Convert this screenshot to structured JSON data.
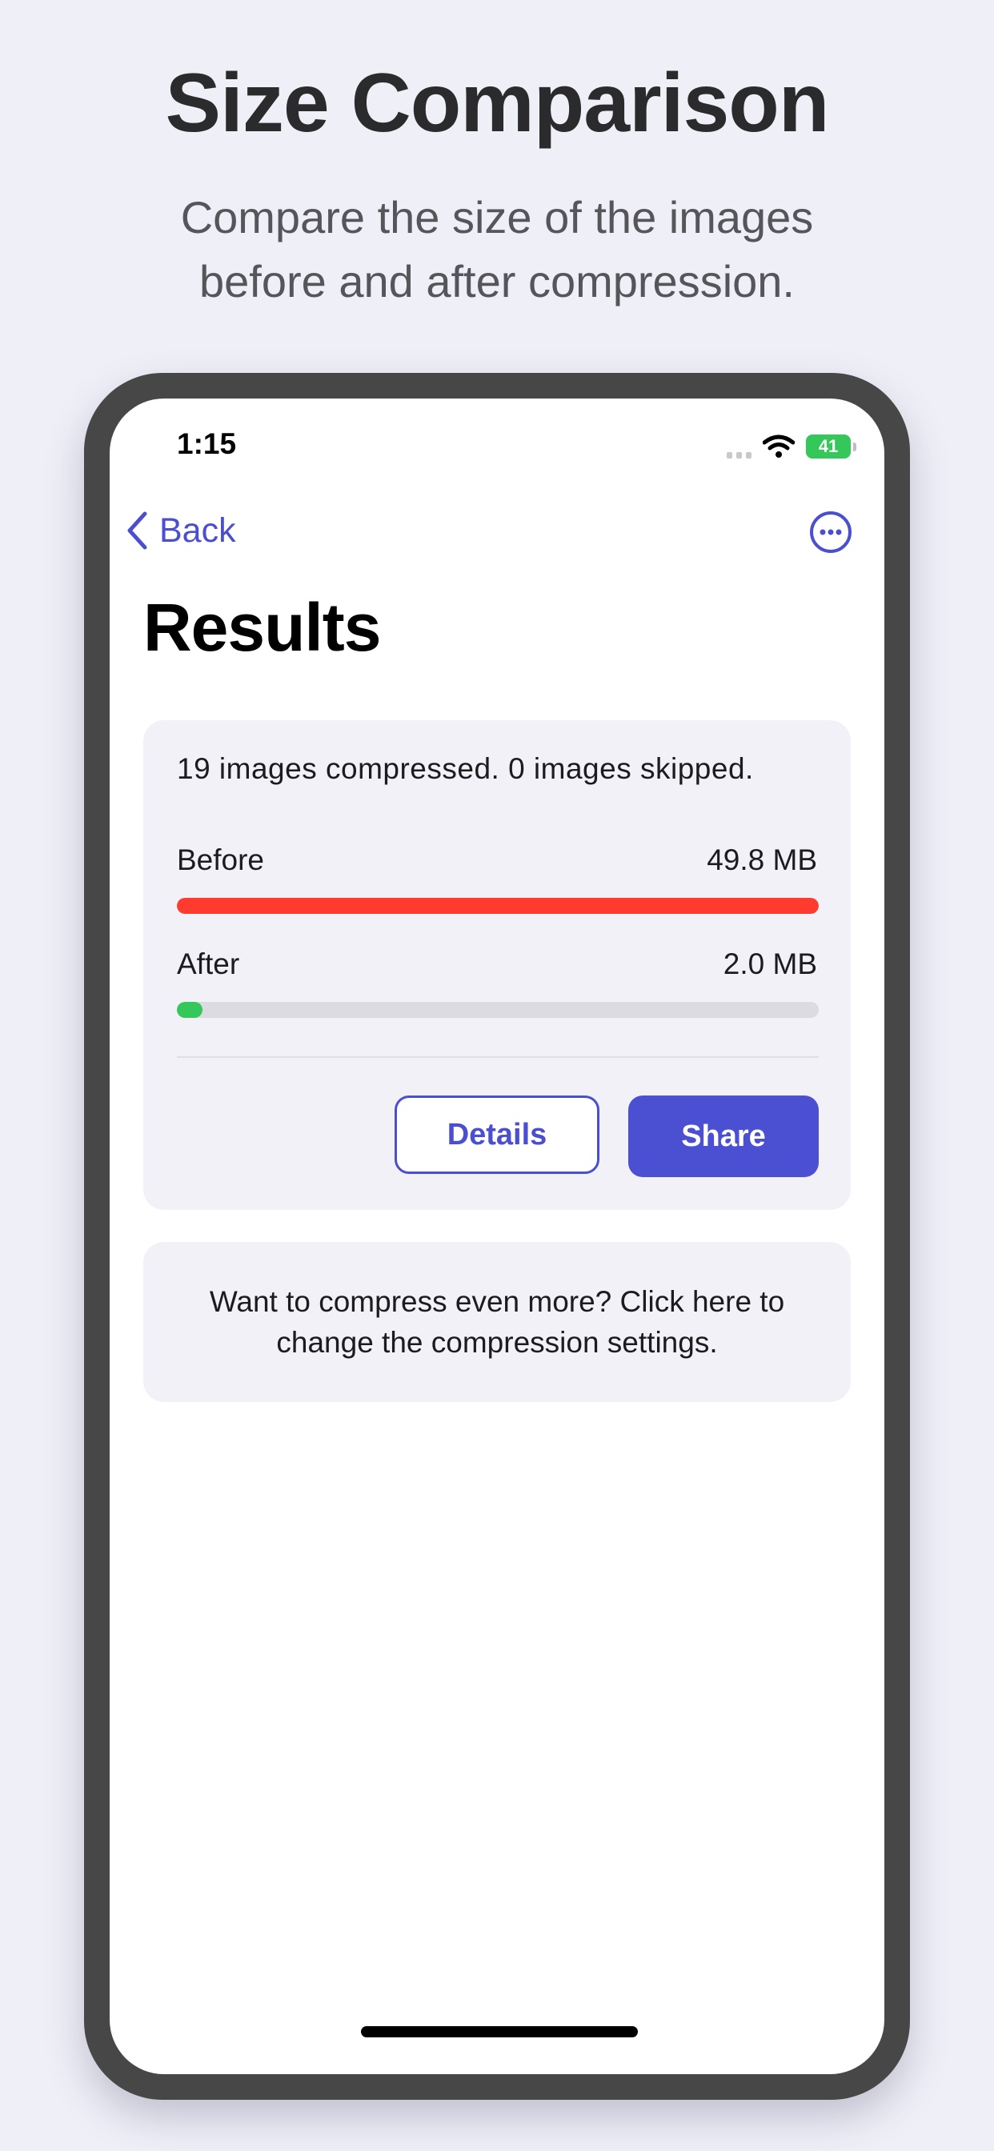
{
  "marketing": {
    "headline": "Size Comparison",
    "subline": "Compare the size of the images before and after compression."
  },
  "status_bar": {
    "time": "1:15",
    "battery": "41"
  },
  "nav": {
    "back_label": "Back"
  },
  "page_title": "Results",
  "results": {
    "summary": "19 images compressed. 0 images skipped.",
    "before": {
      "label": "Before",
      "value": "49.8 MB",
      "fraction": 1.0,
      "color": "#ff3b30"
    },
    "after": {
      "label": "After",
      "value": "2.0 MB",
      "fraction": 0.04,
      "color": "#34c759"
    },
    "details_label": "Details",
    "share_label": "Share"
  },
  "promo": {
    "text": "Want to compress even more? Click here to change the compression settings."
  },
  "colors": {
    "accent": "#4b4fcf",
    "background": "#efeff8"
  }
}
